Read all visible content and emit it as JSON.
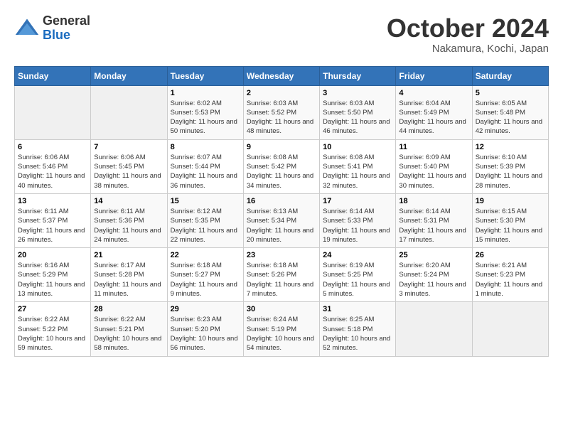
{
  "logo": {
    "general": "General",
    "blue": "Blue"
  },
  "header": {
    "month": "October 2024",
    "location": "Nakamura, Kochi, Japan"
  },
  "days_of_week": [
    "Sunday",
    "Monday",
    "Tuesday",
    "Wednesday",
    "Thursday",
    "Friday",
    "Saturday"
  ],
  "weeks": [
    [
      {
        "day": "",
        "empty": true
      },
      {
        "day": "",
        "empty": true
      },
      {
        "day": "1",
        "sunrise": "6:02 AM",
        "sunset": "5:53 PM",
        "daylight": "11 hours and 50 minutes."
      },
      {
        "day": "2",
        "sunrise": "6:03 AM",
        "sunset": "5:52 PM",
        "daylight": "11 hours and 48 minutes."
      },
      {
        "day": "3",
        "sunrise": "6:03 AM",
        "sunset": "5:50 PM",
        "daylight": "11 hours and 46 minutes."
      },
      {
        "day": "4",
        "sunrise": "6:04 AM",
        "sunset": "5:49 PM",
        "daylight": "11 hours and 44 minutes."
      },
      {
        "day": "5",
        "sunrise": "6:05 AM",
        "sunset": "5:48 PM",
        "daylight": "11 hours and 42 minutes."
      }
    ],
    [
      {
        "day": "6",
        "sunrise": "6:06 AM",
        "sunset": "5:46 PM",
        "daylight": "11 hours and 40 minutes."
      },
      {
        "day": "7",
        "sunrise": "6:06 AM",
        "sunset": "5:45 PM",
        "daylight": "11 hours and 38 minutes."
      },
      {
        "day": "8",
        "sunrise": "6:07 AM",
        "sunset": "5:44 PM",
        "daylight": "11 hours and 36 minutes."
      },
      {
        "day": "9",
        "sunrise": "6:08 AM",
        "sunset": "5:42 PM",
        "daylight": "11 hours and 34 minutes."
      },
      {
        "day": "10",
        "sunrise": "6:08 AM",
        "sunset": "5:41 PM",
        "daylight": "11 hours and 32 minutes."
      },
      {
        "day": "11",
        "sunrise": "6:09 AM",
        "sunset": "5:40 PM",
        "daylight": "11 hours and 30 minutes."
      },
      {
        "day": "12",
        "sunrise": "6:10 AM",
        "sunset": "5:39 PM",
        "daylight": "11 hours and 28 minutes."
      }
    ],
    [
      {
        "day": "13",
        "sunrise": "6:11 AM",
        "sunset": "5:37 PM",
        "daylight": "11 hours and 26 minutes."
      },
      {
        "day": "14",
        "sunrise": "6:11 AM",
        "sunset": "5:36 PM",
        "daylight": "11 hours and 24 minutes."
      },
      {
        "day": "15",
        "sunrise": "6:12 AM",
        "sunset": "5:35 PM",
        "daylight": "11 hours and 22 minutes."
      },
      {
        "day": "16",
        "sunrise": "6:13 AM",
        "sunset": "5:34 PM",
        "daylight": "11 hours and 20 minutes."
      },
      {
        "day": "17",
        "sunrise": "6:14 AM",
        "sunset": "5:33 PM",
        "daylight": "11 hours and 19 minutes."
      },
      {
        "day": "18",
        "sunrise": "6:14 AM",
        "sunset": "5:31 PM",
        "daylight": "11 hours and 17 minutes."
      },
      {
        "day": "19",
        "sunrise": "6:15 AM",
        "sunset": "5:30 PM",
        "daylight": "11 hours and 15 minutes."
      }
    ],
    [
      {
        "day": "20",
        "sunrise": "6:16 AM",
        "sunset": "5:29 PM",
        "daylight": "11 hours and 13 minutes."
      },
      {
        "day": "21",
        "sunrise": "6:17 AM",
        "sunset": "5:28 PM",
        "daylight": "11 hours and 11 minutes."
      },
      {
        "day": "22",
        "sunrise": "6:18 AM",
        "sunset": "5:27 PM",
        "daylight": "11 hours and 9 minutes."
      },
      {
        "day": "23",
        "sunrise": "6:18 AM",
        "sunset": "5:26 PM",
        "daylight": "11 hours and 7 minutes."
      },
      {
        "day": "24",
        "sunrise": "6:19 AM",
        "sunset": "5:25 PM",
        "daylight": "11 hours and 5 minutes."
      },
      {
        "day": "25",
        "sunrise": "6:20 AM",
        "sunset": "5:24 PM",
        "daylight": "11 hours and 3 minutes."
      },
      {
        "day": "26",
        "sunrise": "6:21 AM",
        "sunset": "5:23 PM",
        "daylight": "11 hours and 1 minute."
      }
    ],
    [
      {
        "day": "27",
        "sunrise": "6:22 AM",
        "sunset": "5:22 PM",
        "daylight": "10 hours and 59 minutes."
      },
      {
        "day": "28",
        "sunrise": "6:22 AM",
        "sunset": "5:21 PM",
        "daylight": "10 hours and 58 minutes."
      },
      {
        "day": "29",
        "sunrise": "6:23 AM",
        "sunset": "5:20 PM",
        "daylight": "10 hours and 56 minutes."
      },
      {
        "day": "30",
        "sunrise": "6:24 AM",
        "sunset": "5:19 PM",
        "daylight": "10 hours and 54 minutes."
      },
      {
        "day": "31",
        "sunrise": "6:25 AM",
        "sunset": "5:18 PM",
        "daylight": "10 hours and 52 minutes."
      },
      {
        "day": "",
        "empty": true
      },
      {
        "day": "",
        "empty": true
      }
    ]
  ],
  "labels": {
    "sunrise": "Sunrise:",
    "sunset": "Sunset:",
    "daylight": "Daylight:"
  }
}
